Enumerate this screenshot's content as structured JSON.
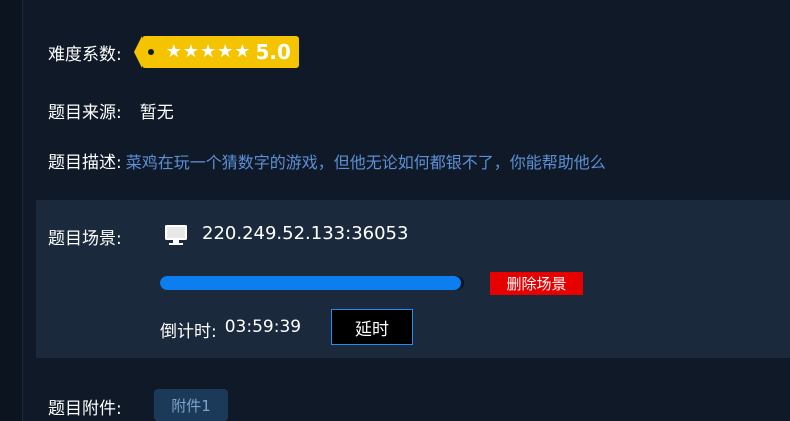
{
  "difficulty": {
    "label": "难度系数:",
    "stars": 5,
    "score": "5.0",
    "badge_color": "#f5c400"
  },
  "source": {
    "label": "题目来源:",
    "value": "暂无"
  },
  "description": {
    "label": "题目描述:",
    "value": "菜鸡在玩一个猜数字的游戏，但他无论如何都银不了，你能帮助他么"
  },
  "scenario": {
    "label": "题目场景:",
    "icon": "monitor-icon",
    "address": "220.249.52.133:36053",
    "progress": 0.99,
    "delete_label": "删除场景",
    "countdown_label": "倒计时:",
    "countdown_value": "03:59:39",
    "extend_label": "延时",
    "colors": {
      "progress": "#0d7ef0",
      "delete": "#e60000",
      "extend_border": "#2a8cf0"
    }
  },
  "attachment": {
    "label": "题目附件:",
    "file_label": "附件1"
  }
}
